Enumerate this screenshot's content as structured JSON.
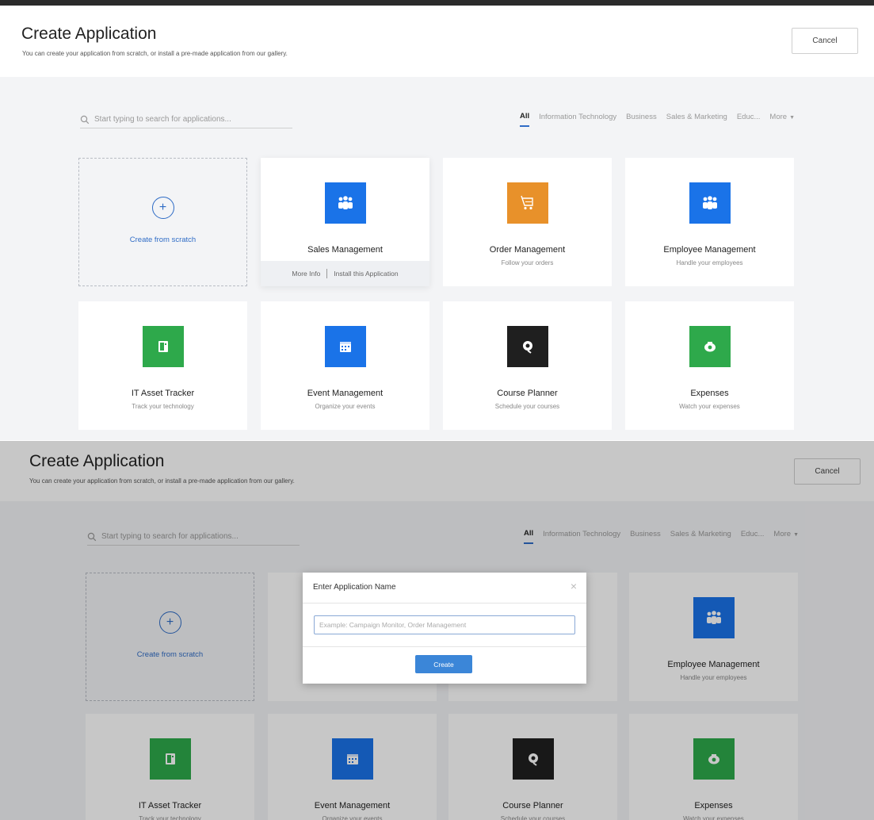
{
  "header": {
    "title": "Create Application",
    "subtitle": "You can create your application from scratch, or install a pre-made application from our gallery.",
    "cancel_label": "Cancel"
  },
  "search": {
    "placeholder": "Start typing to search for applications..."
  },
  "filters": [
    {
      "label": "All",
      "active": true
    },
    {
      "label": "Information Technology",
      "active": false
    },
    {
      "label": "Business",
      "active": false
    },
    {
      "label": "Sales & Marketing",
      "active": false
    },
    {
      "label": "Educ...",
      "active": false
    },
    {
      "label": "More",
      "active": false
    }
  ],
  "scratch_label": "Create from scratch",
  "cards": [
    {
      "name": "Sales Management",
      "desc": "",
      "color": "#1a73e8",
      "icon": "people-icon"
    },
    {
      "name": "Order Management",
      "desc": "Follow your orders",
      "color": "#e8912a",
      "icon": "cart-icon"
    },
    {
      "name": "Employee Management",
      "desc": "Handle your employees",
      "color": "#1a73e8",
      "icon": "people-icon"
    },
    {
      "name": "IT Asset Tracker",
      "desc": "Track your technology",
      "color": "#2ea94b",
      "icon": "device-icon"
    },
    {
      "name": "Event Management",
      "desc": "Organize your events",
      "color": "#1a73e8",
      "icon": "calendar-icon"
    },
    {
      "name": "Course Planner",
      "desc": "Schedule your courses",
      "color": "#1f1f1f",
      "icon": "course-icon"
    },
    {
      "name": "Expenses",
      "desc": "Watch your expenses",
      "color": "#2ea94b",
      "icon": "piggy-bank-icon"
    }
  ],
  "hover_footer": {
    "more_info": "More Info",
    "install": "Install this Application"
  },
  "modal": {
    "title": "Enter Application Name",
    "placeholder": "Example: Campaign Monitor, Order Management",
    "create_label": "Create"
  }
}
